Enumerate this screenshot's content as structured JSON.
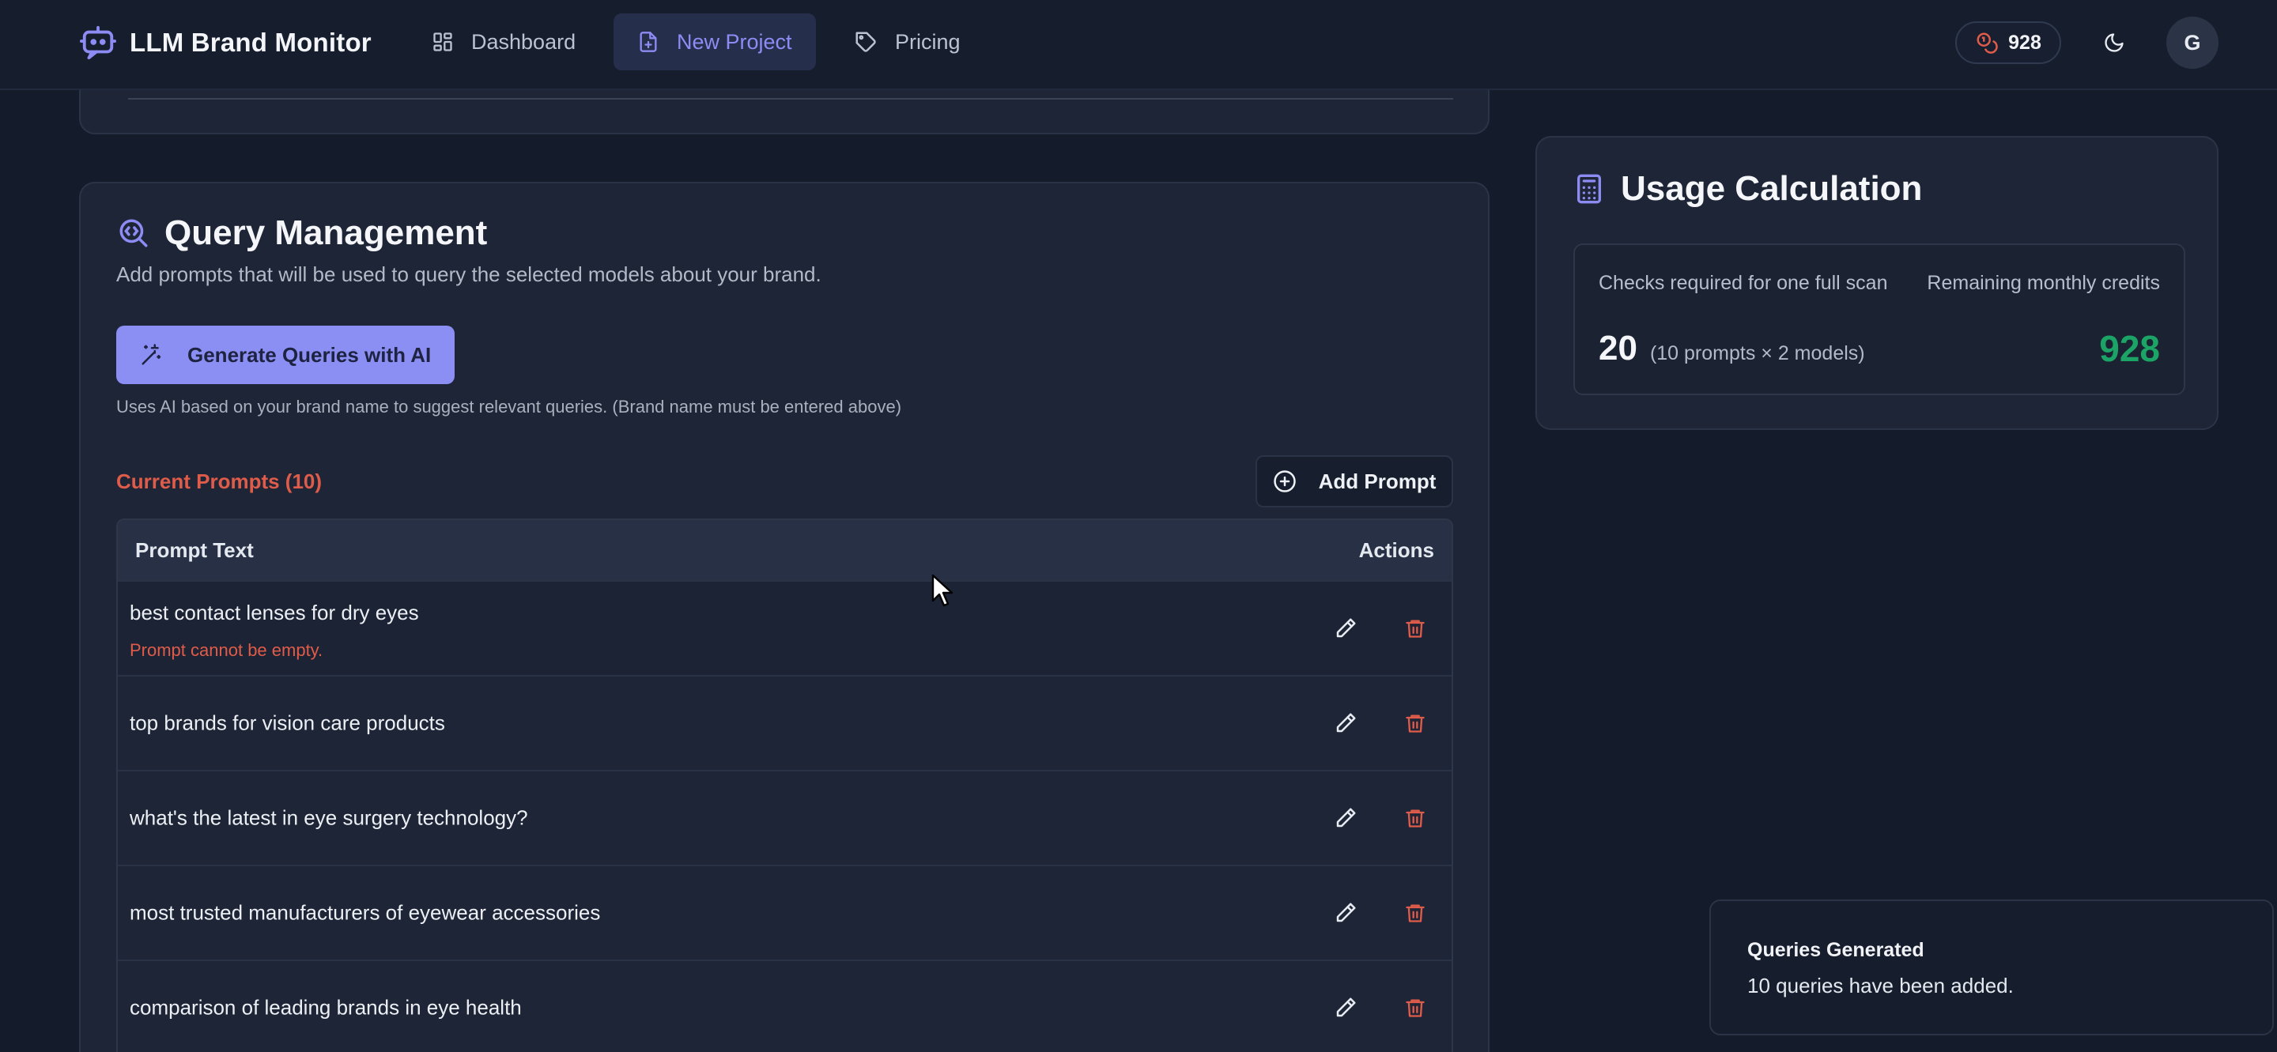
{
  "app": {
    "name": "LLM Brand Monitor"
  },
  "nav": {
    "items": [
      {
        "label": "Dashboard",
        "icon": "grid-icon"
      },
      {
        "label": "New Project",
        "icon": "file-plus-icon",
        "active": true
      },
      {
        "label": "Pricing",
        "icon": "tag-icon"
      }
    ],
    "credits": "928",
    "avatar_initial": "G"
  },
  "query_management": {
    "title": "Query Management",
    "subtitle": "Add prompts that will be used to query the selected models about your brand.",
    "generate_label": "Generate Queries with AI",
    "generate_note": "Uses AI based on your brand name to suggest relevant queries. (Brand name must be entered above)",
    "current_prompts_label": "Current Prompts (10)",
    "add_prompt_label": "Add Prompt",
    "table": {
      "columns": [
        "Prompt Text",
        "Actions"
      ],
      "rows": [
        {
          "text": "best contact lenses for dry eyes",
          "error": "Prompt cannot be empty."
        },
        {
          "text": "top brands for vision care products"
        },
        {
          "text": "what's the latest in eye surgery technology?"
        },
        {
          "text": "most trusted manufacturers of eyewear accessories"
        },
        {
          "text": "comparison of leading brands in eye health"
        }
      ]
    }
  },
  "usage": {
    "title": "Usage Calculation",
    "checks_label": "Checks required for one full scan",
    "checks_value": "20",
    "checks_detail": "(10 prompts × 2 models)",
    "remaining_label": "Remaining monthly credits",
    "remaining_value": "928"
  },
  "toast": {
    "title": "Queries Generated",
    "message": "10 queries have been added."
  },
  "colors": {
    "accent": "#8b8ef3",
    "error": "#e05c4a",
    "success": "#1ba466",
    "background": "#141b2b",
    "card": "#1e2536"
  }
}
